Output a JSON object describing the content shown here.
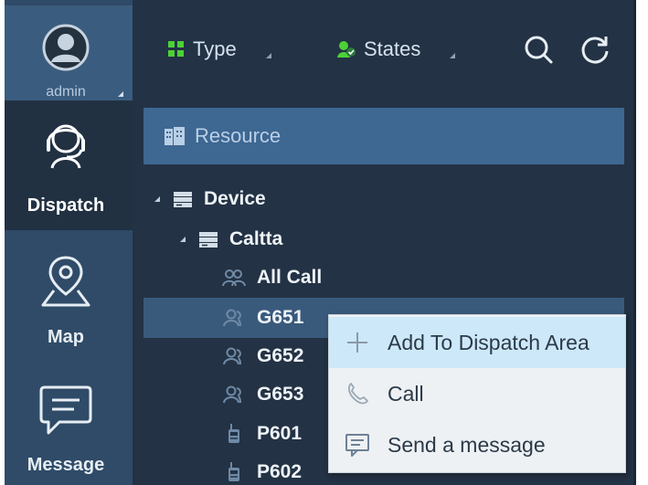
{
  "user": {
    "name": "admin"
  },
  "nav": {
    "dispatch": "Dispatch",
    "map": "Map",
    "message": "Message"
  },
  "filters": {
    "type": "Type",
    "states": "States"
  },
  "resource": {
    "title": "Resource"
  },
  "tree": {
    "device": "Device",
    "group": "Caltta",
    "all_call": "All Call",
    "talkgroups": [
      "G651",
      "G652",
      "G653"
    ],
    "terminals": [
      "P601",
      "P602"
    ],
    "selected": "G651"
  },
  "context_menu": {
    "items": [
      {
        "label": "Add To Dispatch Area",
        "icon": "plus-icon"
      },
      {
        "label": "Call",
        "icon": "phone-icon"
      },
      {
        "label": "Send a message",
        "icon": "message-icon"
      }
    ],
    "highlighted": "Add To Dispatch Area"
  },
  "colors": {
    "rail": "#2f4b68",
    "active_nav": "#213142",
    "panel": "#233244",
    "resource_header": "#3e6792",
    "selected_row": "#3a5a7c",
    "menu_highlight": "#cde8f8",
    "type_icon_green": "#4cd137"
  }
}
